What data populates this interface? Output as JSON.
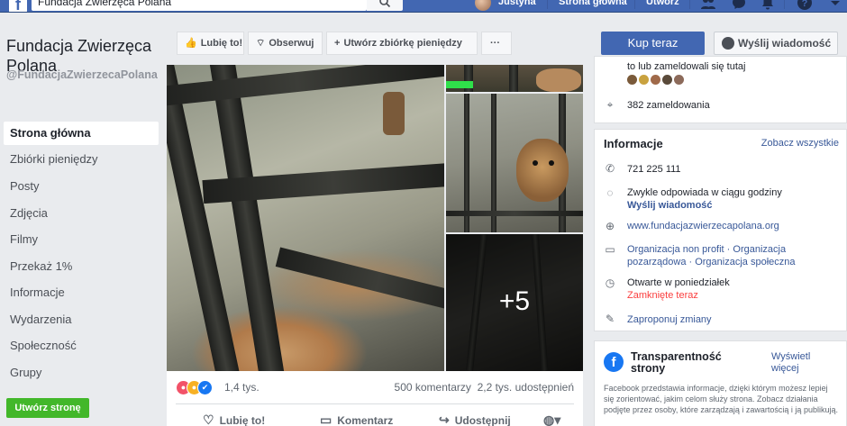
{
  "topbar": {
    "search_value": "Fundacja Zwierzęca Polana",
    "user_name": "Justyna",
    "nav_home": "Strona główna",
    "nav_create": "Utwórz"
  },
  "sidebar": {
    "page_name": "Fundacja Zwierzęca Polana",
    "page_handle": "@FundacjaZwierzecaPolana",
    "items": [
      {
        "label": "Strona główna"
      },
      {
        "label": "Zbiórki pieniędzy"
      },
      {
        "label": "Posty"
      },
      {
        "label": "Zdjęcia"
      },
      {
        "label": "Filmy"
      },
      {
        "label": "Przekaż 1%"
      },
      {
        "label": "Informacje"
      },
      {
        "label": "Wydarzenia"
      },
      {
        "label": "Społeczność"
      },
      {
        "label": "Grupy"
      }
    ],
    "create_page_label": "Utwórz stronę"
  },
  "actions": {
    "like": "Lubię to!",
    "follow": "Obserwuj",
    "fundraiser": "Utwórz zbiórkę pieniędzy",
    "more": "···",
    "buy": "Kup teraz",
    "message": "Wyślij wiadomość"
  },
  "photos": {
    "more_count": "+5"
  },
  "post": {
    "reactions_count": "1,4 tys.",
    "comments": "500 komentarzy",
    "shares": "2,2 tys. udostępnień",
    "like_btn": "Lubię to!",
    "comment_btn": "Komentarz",
    "share_btn": "Udostępnij"
  },
  "right": {
    "checkin_text": "to lub zameldowali się tutaj",
    "checkins": "382 zameldowania",
    "info_title": "Informacje",
    "see_all": "Zobacz wszystkie",
    "phone": "721 225 111",
    "response": "Zwykle odpowiada w ciągu godziny",
    "send_message": "Wyślij wiadomość",
    "website": "www.fundacjazwierzecapolana.org",
    "category_line1": "Organizacja non profit · Organizacja",
    "category_line2": "pozarządowa · Organizacja społeczna",
    "hours": "Otwarte w poniedziałek",
    "closed_now": "Zamknięte teraz",
    "suggest_edits": "Zaproponuj zmiany",
    "transparency_title": "Transparentność strony",
    "transparency_more": "Wyświetl więcej",
    "transparency_desc": "Facebook przedstawia informacje, dzięki którym możesz lepiej się zorientować, jakim celom służy strona. Zobacz działania podjęte przez osoby, które zarządzają i zawartością i ją publikują."
  },
  "colors": {
    "brand": "#4267b2",
    "create_green": "#42b72a",
    "link": "#385898",
    "closed_red": "#fa3e3e"
  }
}
